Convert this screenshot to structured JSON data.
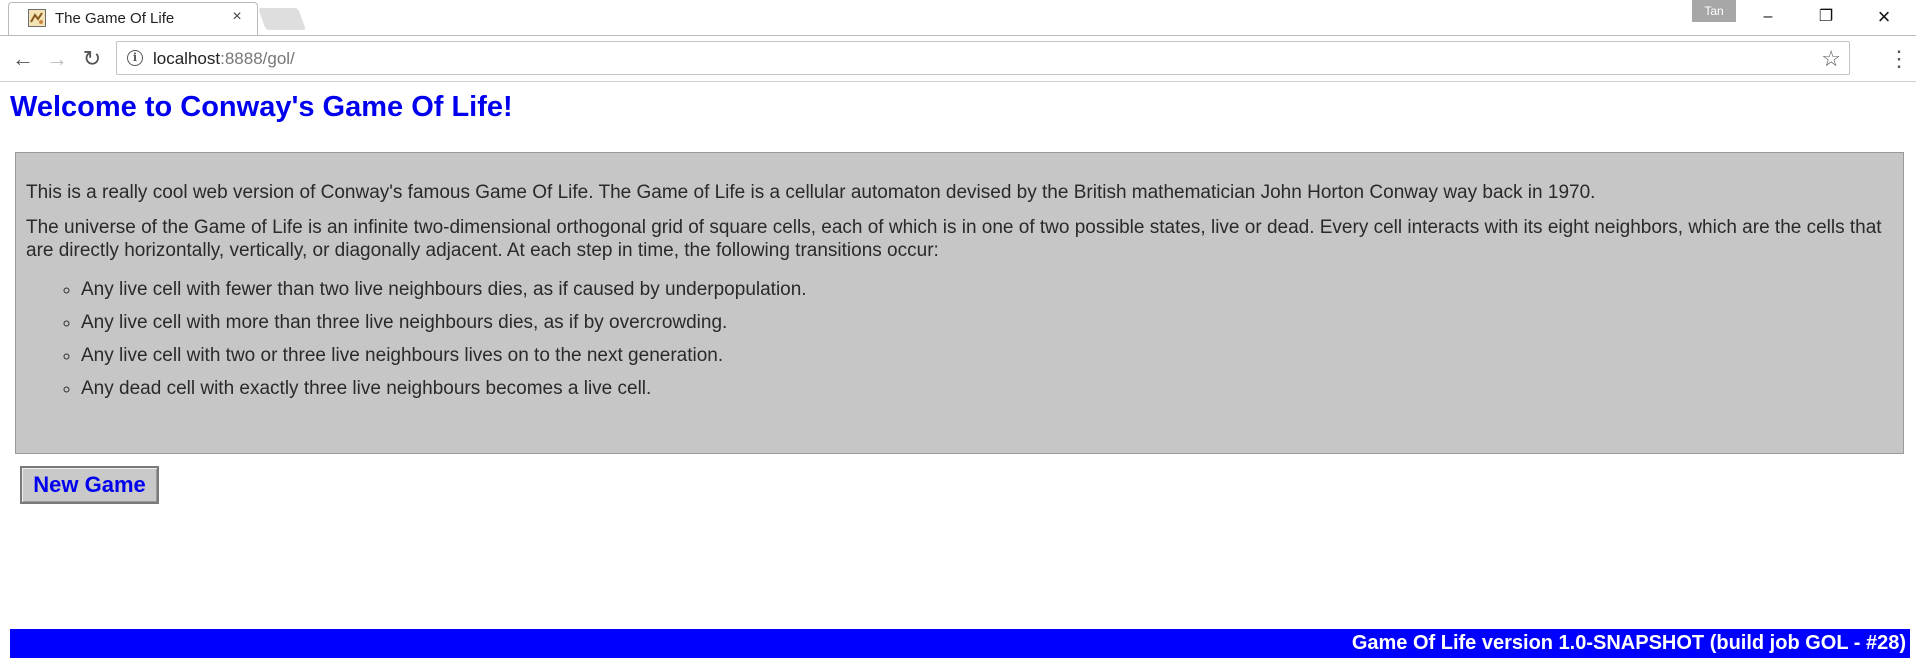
{
  "browser": {
    "tab_title": "The Game Of Life",
    "tab_close": "×",
    "profile_name": "Tan",
    "window_controls": {
      "minimize": "–",
      "maximize": "❐",
      "close": "×"
    },
    "nav": {
      "back": "←",
      "forward": "→",
      "reload": "↻",
      "menu": "⋮"
    },
    "url_host": "localhost",
    "url_rest": ":8888/gol/",
    "info_icon": "i",
    "bookmark_icon": "☆"
  },
  "page": {
    "heading": "Welcome to Conway's Game Of Life!",
    "intro": "This is a really cool web version of Conway's famous Game Of Life. The Game of Life is a cellular automaton devised by the British mathematician John Horton Conway way back in 1970.",
    "description": "The universe of the Game of Life is an infinite two-dimensional orthogonal grid of square cells, each of which is in one of two possible states, live or dead. Every cell interacts with its eight neighbors, which are the cells that are directly horizontally, vertically, or diagonally adjacent. At each step in time, the following transitions occur:",
    "rules": [
      "Any live cell with fewer than two live neighbours dies, as if caused by underpopulation.",
      "Any live cell with more than three live neighbours dies, as if by overcrowding.",
      "Any live cell with two or three live neighbours lives on to the next generation.",
      "Any dead cell with exactly three live neighbours becomes a live cell."
    ],
    "new_game_label": "New Game",
    "footer": "Game Of Life version 1.0-SNAPSHOT (build job GOL - #28)"
  },
  "colors": {
    "heading": "#0000ee",
    "info_box_bg": "#c6c6c6",
    "footer_bg": "#0000ff"
  }
}
